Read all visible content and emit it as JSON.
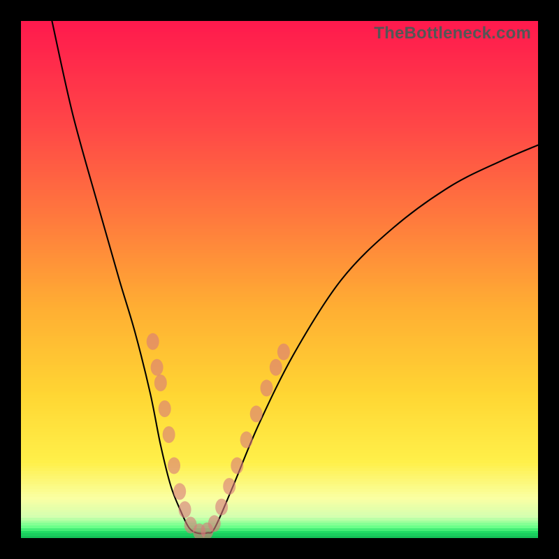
{
  "watermark": "TheBottleneck.com",
  "chart_data": {
    "type": "line",
    "title": "",
    "xlabel": "",
    "ylabel": "",
    "xlim": [
      0,
      100
    ],
    "ylim": [
      0,
      100
    ],
    "legend": "none",
    "grid": false,
    "description": "V-shaped bottleneck curve over a red→orange→yellow→green vertical gradient. Salmon-colored bead markers decorate both descending limbs of the V near its minimum. The minimum of the curve touches a thin green band at the bottom of the plot.",
    "series": [
      {
        "name": "left-limb",
        "x": [
          6,
          10,
          15,
          19,
          22,
          25,
          27,
          29,
          31,
          32.5
        ],
        "y": [
          100,
          82,
          64,
          50,
          40,
          28,
          18,
          10,
          5,
          2
        ]
      },
      {
        "name": "valley",
        "x": [
          32.5,
          34,
          36,
          37.5
        ],
        "y": [
          2,
          1,
          1,
          2
        ]
      },
      {
        "name": "right-limb",
        "x": [
          37.5,
          41,
          46,
          53,
          62,
          72,
          83,
          93,
          100
        ],
        "y": [
          2,
          10,
          22,
          36,
          50,
          60,
          68,
          73,
          76
        ]
      }
    ],
    "markers": {
      "name": "beads",
      "color": "#d97a7a",
      "points": [
        {
          "x": 25.5,
          "y": 38
        },
        {
          "x": 26.3,
          "y": 33
        },
        {
          "x": 27.0,
          "y": 30
        },
        {
          "x": 27.8,
          "y": 25
        },
        {
          "x": 28.6,
          "y": 20
        },
        {
          "x": 29.6,
          "y": 14
        },
        {
          "x": 30.7,
          "y": 9
        },
        {
          "x": 31.7,
          "y": 5.5
        },
        {
          "x": 32.8,
          "y": 2.5
        },
        {
          "x": 34.5,
          "y": 1.2
        },
        {
          "x": 36.0,
          "y": 1.4
        },
        {
          "x": 37.4,
          "y": 2.8
        },
        {
          "x": 38.8,
          "y": 6
        },
        {
          "x": 40.3,
          "y": 10
        },
        {
          "x": 41.8,
          "y": 14
        },
        {
          "x": 43.6,
          "y": 19
        },
        {
          "x": 45.5,
          "y": 24
        },
        {
          "x": 47.5,
          "y": 29
        },
        {
          "x": 49.3,
          "y": 33
        },
        {
          "x": 50.8,
          "y": 36
        }
      ]
    },
    "gradient_stops": [
      {
        "pos": 0.0,
        "color": "#ff1a4d"
      },
      {
        "pos": 0.2,
        "color": "#ff4747"
      },
      {
        "pos": 0.38,
        "color": "#ff7a3d"
      },
      {
        "pos": 0.55,
        "color": "#ffae33"
      },
      {
        "pos": 0.72,
        "color": "#ffd633"
      },
      {
        "pos": 0.85,
        "color": "#fff04a"
      },
      {
        "pos": 0.92,
        "color": "#faffa3"
      },
      {
        "pos": 0.955,
        "color": "#d4ffb0"
      },
      {
        "pos": 0.975,
        "color": "#6aff8a"
      },
      {
        "pos": 0.985,
        "color": "#1fdc64"
      },
      {
        "pos": 1.0,
        "color": "#10b352"
      }
    ]
  }
}
